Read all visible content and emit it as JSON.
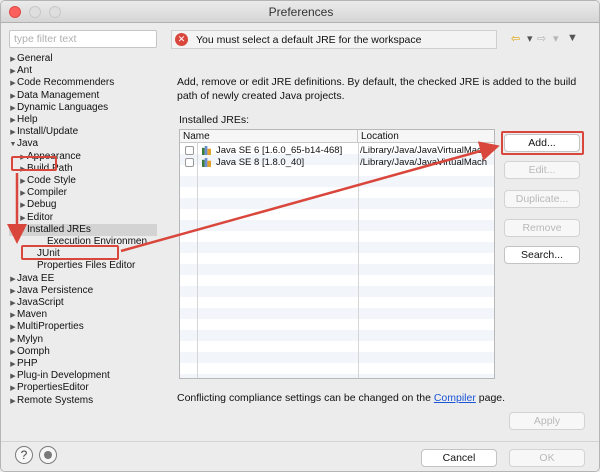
{
  "window": {
    "title": "Preferences"
  },
  "filter": {
    "placeholder": "type filter text"
  },
  "tree": [
    {
      "label": "General",
      "arrow": "▶",
      "indent": 0
    },
    {
      "label": "Ant",
      "arrow": "▶",
      "indent": 0
    },
    {
      "label": "Code Recommenders",
      "arrow": "▶",
      "indent": 0
    },
    {
      "label": "Data Management",
      "arrow": "▶",
      "indent": 0
    },
    {
      "label": "Dynamic Languages",
      "arrow": "▶",
      "indent": 0
    },
    {
      "label": "Help",
      "arrow": "▶",
      "indent": 0
    },
    {
      "label": "Install/Update",
      "arrow": "▶",
      "indent": 0
    },
    {
      "label": "Java",
      "arrow": "▼",
      "indent": 0
    },
    {
      "label": "Appearance",
      "arrow": "▶",
      "indent": 1
    },
    {
      "label": "Build Path",
      "arrow": "▶",
      "indent": 1
    },
    {
      "label": "Code Style",
      "arrow": "▶",
      "indent": 1
    },
    {
      "label": "Compiler",
      "arrow": "▶",
      "indent": 1
    },
    {
      "label": "Debug",
      "arrow": "▶",
      "indent": 1
    },
    {
      "label": "Editor",
      "arrow": "▶",
      "indent": 1
    },
    {
      "label": "Installed JREs",
      "arrow": "▼",
      "indent": 1,
      "selected": true
    },
    {
      "label": "Execution Environmen",
      "arrow": "",
      "indent": 3
    },
    {
      "label": "JUnit",
      "arrow": "",
      "indent": 2
    },
    {
      "label": "Properties Files Editor",
      "arrow": "",
      "indent": 2
    },
    {
      "label": "Java EE",
      "arrow": "▶",
      "indent": 0
    },
    {
      "label": "Java Persistence",
      "arrow": "▶",
      "indent": 0
    },
    {
      "label": "JavaScript",
      "arrow": "▶",
      "indent": 0
    },
    {
      "label": "Maven",
      "arrow": "▶",
      "indent": 0
    },
    {
      "label": "MultiProperties",
      "arrow": "▶",
      "indent": 0
    },
    {
      "label": "Mylyn",
      "arrow": "▶",
      "indent": 0
    },
    {
      "label": "Oomph",
      "arrow": "▶",
      "indent": 0
    },
    {
      "label": "PHP",
      "arrow": "▶",
      "indent": 0
    },
    {
      "label": "Plug-in Development",
      "arrow": "▶",
      "indent": 0
    },
    {
      "label": "PropertiesEditor",
      "arrow": "▶",
      "indent": 0
    },
    {
      "label": "Remote Systems",
      "arrow": "▶",
      "indent": 0
    }
  ],
  "error": {
    "icon": "error-icon",
    "message": "You must select a default JRE for the workspace"
  },
  "nav": {
    "back": "⇦",
    "back_menu": "▾",
    "forward": "⇨",
    "forward_menu": "▾",
    "view_menu": "▼"
  },
  "description": "Add, remove or edit JRE definitions. By default, the checked JRE is added to the build path of newly created Java projects.",
  "installed_label": "Installed JREs:",
  "table": {
    "headers": {
      "name": "Name",
      "location": "Location"
    },
    "rows": [
      {
        "name": "Java SE 6 [1.6.0_65-b14-468]",
        "location": "/Library/Java/JavaVirtualMach",
        "checked": false
      },
      {
        "name": "Java SE 8 [1.8.0_40]",
        "location": "/Library/Java/JavaVirtualMach",
        "checked": false
      }
    ]
  },
  "buttons": {
    "add": "Add...",
    "edit": "Edit...",
    "duplicate": "Duplicate...",
    "remove": "Remove",
    "search": "Search...",
    "apply": "Apply",
    "cancel": "Cancel",
    "ok": "OK"
  },
  "compliance": {
    "prefix": "Conflicting compliance settings can be changed on the ",
    "link": "Compiler",
    "suffix": " page."
  },
  "footer": {
    "help": "?"
  },
  "colors": {
    "annotation": "#d9473c",
    "link": "#1a55d6",
    "selection": "#d3d3d3"
  }
}
